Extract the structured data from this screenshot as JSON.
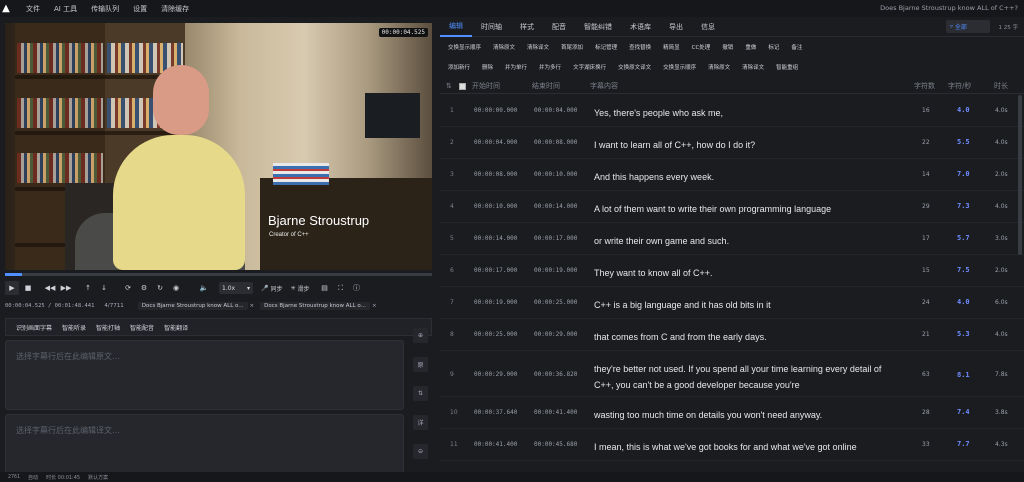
{
  "menubar": {
    "items": [
      "文件",
      "AI 工具",
      "传输队列",
      "设置",
      "清除缓存"
    ],
    "window_title": "Does Bjarne Stroustrup know ALL of C++?"
  },
  "video": {
    "timecode": "00:00:04.525",
    "lower_third_name": "Bjarne Stroustrup",
    "lower_third_role": "Creator of C++",
    "progress": 0.04
  },
  "controls": {
    "speed": "1.0x",
    "sync_label": "同步",
    "step_label": "滑步"
  },
  "infobar": {
    "position": "00:00:04.525 / 00:01:48.441",
    "counter": "4/7711",
    "docs": [
      "Docs Bjarne Stroustrup know ALL o...",
      "Docs Bjarne Stroustrup know ALL o..."
    ]
  },
  "ai_tools": [
    "识别画面字幕",
    "智能听录",
    "智能打轴",
    "智能配音",
    "智能翻译"
  ],
  "editor": {
    "source_placeholder": "选择字幕行后在此编辑原文...",
    "translation_placeholder": "选择字幕行后在此编辑译文..."
  },
  "side_buttons": [
    "原",
    "详"
  ],
  "statusbar": [
    "2761",
    "自动",
    "时长 00:01:45",
    "默认方案"
  ],
  "tabs": [
    "编辑",
    "时间轴",
    "样式",
    "配音",
    "智能纠错",
    "术语库",
    "导出",
    "信息"
  ],
  "filter": {
    "label": "全部",
    "count": "1 25 字"
  },
  "toolbar_row1": [
    "交换显示顺序",
    "清除原文",
    "清除译文",
    "首尾添加",
    "标记管理",
    "查找替换",
    "精简显",
    "CC处理",
    "撤销",
    "重做",
    "标记",
    "备注"
  ],
  "toolbar_row2": [
    "添加新行",
    "删除",
    "并为单行",
    "并为多行",
    "文字湖床换行",
    "交换原文译文",
    "交换显示顺序",
    "清除原文",
    "清除译文",
    "智能重组"
  ],
  "table": {
    "headers": [
      "开始时间",
      "结束时间",
      "字幕内容",
      "字符数",
      "字符/秒",
      "时长"
    ],
    "rows": [
      {
        "n": "1",
        "start": "00:00:00.000",
        "end": "00:00:04.000",
        "text": "Yes, there's people who ask me,",
        "chars": "16",
        "cps": "4.0",
        "dur": "4.0s"
      },
      {
        "n": "2",
        "start": "00:00:04.000",
        "end": "00:00:08.000",
        "text": "I want to learn all of C++, how do I do it?",
        "chars": "22",
        "cps": "5.5",
        "dur": "4.0s"
      },
      {
        "n": "3",
        "start": "00:00:08.000",
        "end": "00:00:10.000",
        "text": "And this happens every week.",
        "chars": "14",
        "cps": "7.0",
        "dur": "2.0s"
      },
      {
        "n": "4",
        "start": "00:00:10.000",
        "end": "00:00:14.000",
        "text": "A lot of them want to write their own programming language",
        "chars": "29",
        "cps": "7.3",
        "dur": "4.0s"
      },
      {
        "n": "5",
        "start": "00:00:14.000",
        "end": "00:00:17.000",
        "text": "or write their own game and such.",
        "chars": "17",
        "cps": "5.7",
        "dur": "3.0s"
      },
      {
        "n": "6",
        "start": "00:00:17.000",
        "end": "00:00:19.000",
        "text": "They want to know all of C++.",
        "chars": "15",
        "cps": "7.5",
        "dur": "2.0s"
      },
      {
        "n": "7",
        "start": "00:00:19.000",
        "end": "00:00:25.000",
        "text": "C++ is a big language and it has old bits in it",
        "chars": "24",
        "cps": "4.0",
        "dur": "6.0s"
      },
      {
        "n": "8",
        "start": "00:00:25.000",
        "end": "00:00:29.000",
        "text": "that comes from C and from the early days.",
        "chars": "21",
        "cps": "5.3",
        "dur": "4.0s"
      },
      {
        "n": "9",
        "start": "00:00:29.000",
        "end": "00:00:36.820",
        "text": "they're better not used. If you spend all your time learning every detail of C++, you can't be a good developer because you're",
        "chars": "63",
        "cps": "8.1",
        "dur": "7.8s"
      },
      {
        "n": "10",
        "start": "00:00:37.640",
        "end": "00:00:41.400",
        "text": "wasting too much time on details you won't need anyway.",
        "chars": "28",
        "cps": "7.4",
        "dur": "3.8s"
      },
      {
        "n": "11",
        "start": "00:00:41.400",
        "end": "00:00:45.680",
        "text": "I mean, this is what we've got books for and what we've got online",
        "chars": "33",
        "cps": "7.7",
        "dur": "4.3s"
      }
    ]
  }
}
